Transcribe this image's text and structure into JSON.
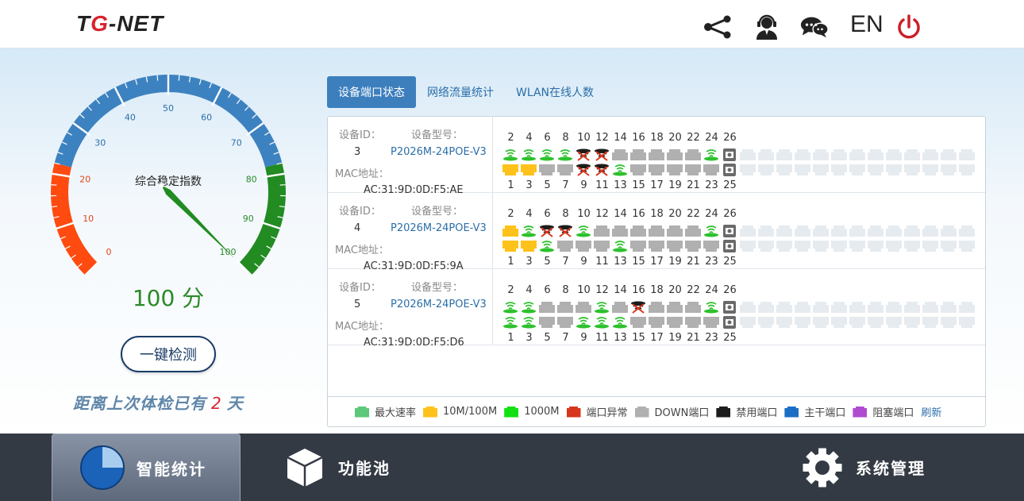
{
  "header": {
    "logo": {
      "prefix": "T",
      "accent": "G",
      "suffix": "-NET"
    },
    "icons": [
      "share-icon",
      "support-agent-icon",
      "chat-icon",
      "power-icon"
    ],
    "lang_label": "EN"
  },
  "gauge": {
    "title": "综合稳定指数",
    "score": "100 分",
    "score_value": 100,
    "ticks": [
      "0",
      "10",
      "20",
      "30",
      "40",
      "50",
      "60",
      "70",
      "80",
      "90",
      "100"
    ],
    "colors": {
      "low": "#ff4a10",
      "mid": "#3d82c0",
      "high": "#228b22"
    }
  },
  "detect_button": "一键检测",
  "last_check": {
    "prefix": "距离上次体检已有",
    "days": "2",
    "suffix": "天"
  },
  "tabs": [
    {
      "label": "设备端口状态",
      "active": true
    },
    {
      "label": "网络流量统计",
      "active": false
    },
    {
      "label": "WLAN在线人数",
      "active": false
    }
  ],
  "device_labels": {
    "id": "设备ID：",
    "model": "设备型号：",
    "mac": "MAC地址："
  },
  "port_numbers": {
    "top": [
      "2",
      "4",
      "6",
      "8",
      "10",
      "12",
      "14",
      "16",
      "18",
      "20",
      "22",
      "24",
      "26"
    ],
    "bottom": [
      "1",
      "3",
      "5",
      "7",
      "9",
      "11",
      "13",
      "15",
      "17",
      "19",
      "21",
      "23",
      "25"
    ]
  },
  "devices": [
    {
      "id": "3",
      "model": "P2026M-24POE-V3",
      "mac": "AC:31:9D:0D:F5:AE",
      "ports_top": [
        "green",
        "green",
        "green",
        "green",
        "black",
        "black",
        "down",
        "down",
        "down",
        "down",
        "down",
        "green",
        "sfp"
      ],
      "ports_bottom": [
        "yellow",
        "yellow",
        "down",
        "down",
        "black",
        "black",
        "green",
        "down",
        "down",
        "down",
        "down",
        "down",
        "sfp"
      ]
    },
    {
      "id": "4",
      "model": "P2026M-24POE-V3",
      "mac": "AC:31:9D:0D:F5:9A",
      "ports_top": [
        "yellow",
        "green",
        "black",
        "black",
        "green",
        "down",
        "down",
        "down",
        "down",
        "down",
        "down",
        "green",
        "sfp"
      ],
      "ports_bottom": [
        "yellow",
        "yellow",
        "green",
        "down",
        "down",
        "down",
        "green",
        "down",
        "down",
        "down",
        "down",
        "down",
        "sfp"
      ]
    },
    {
      "id": "5",
      "model": "P2026M-24POE-V3",
      "mac": "AC:31:9D:0D:F5:D6",
      "ports_top": [
        "green",
        "green",
        "down",
        "down",
        "down",
        "green",
        "down",
        "black",
        "down",
        "down",
        "down",
        "green",
        "sfp"
      ],
      "ports_bottom": [
        "green",
        "green",
        "down",
        "down",
        "green",
        "green",
        "green",
        "down",
        "down",
        "down",
        "down",
        "down",
        "sfp"
      ]
    }
  ],
  "legend": [
    {
      "label": "最大速率",
      "color": "#5cc87a"
    },
    {
      "label": "10M/100M",
      "color": "#ffc21a"
    },
    {
      "label": "1000M",
      "color": "#12e012"
    },
    {
      "label": "端口异常",
      "color": "#d8361c"
    },
    {
      "label": "DOWN端口",
      "color": "#b0b0b0"
    },
    {
      "label": "禁用端口",
      "color": "#1c1c1c"
    },
    {
      "label": "主干端口",
      "color": "#1a6ec4"
    },
    {
      "label": "阻塞端口",
      "color": "#b04ad0"
    }
  ],
  "refresh_label": "刷新",
  "bottom_nav": [
    {
      "label": "智能统计",
      "icon": "pie-chart-icon",
      "active": true
    },
    {
      "label": "功能池",
      "icon": "cube-icon",
      "active": false
    },
    {
      "label": "系统管理",
      "icon": "gear-icon",
      "active": false
    }
  ]
}
